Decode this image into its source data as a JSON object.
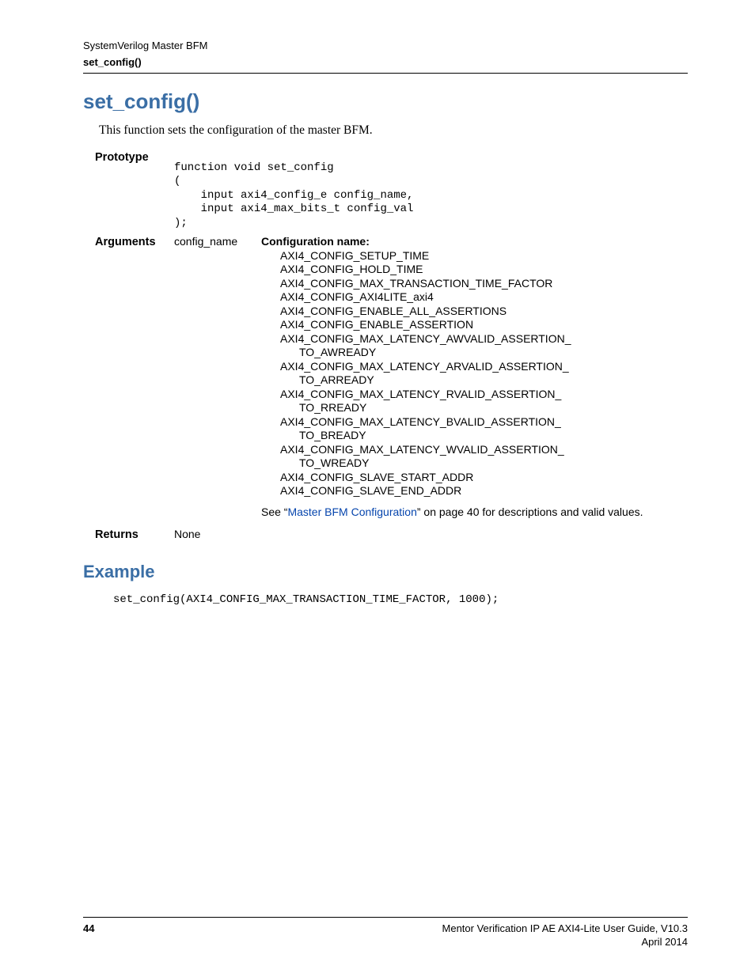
{
  "header": {
    "line1": "SystemVerilog Master BFM",
    "line2": "set_config()"
  },
  "title": "set_config()",
  "intro": "This function sets the configuration of the master BFM.",
  "prototype": {
    "label": "Prototype",
    "code": "function void set_config\n(\n    input axi4_config_e config_name,\n    input axi4_max_bits_t config_val\n);"
  },
  "arguments": {
    "label": "Arguments",
    "arg_name": "config_name",
    "desc_label": "Configuration name:",
    "items": [
      "AXI4_CONFIG_SETUP_TIME",
      "AXI4_CONFIG_HOLD_TIME",
      "AXI4_CONFIG_MAX_TRANSACTION_TIME_FACTOR",
      "AXI4_CONFIG_AXI4LITE_axi4",
      "AXI4_CONFIG_ENABLE_ALL_ASSERTIONS",
      "AXI4_CONFIG_ENABLE_ASSERTION"
    ],
    "wrapped": [
      {
        "line1": "AXI4_CONFIG_MAX_LATENCY_AWVALID_ASSERTION_",
        "line2": "TO_AWREADY"
      },
      {
        "line1": "AXI4_CONFIG_MAX_LATENCY_ARVALID_ASSERTION_",
        "line2": "TO_ARREADY"
      },
      {
        "line1": "AXI4_CONFIG_MAX_LATENCY_RVALID_ASSERTION_",
        "line2": "TO_RREADY"
      },
      {
        "line1": "AXI4_CONFIG_MAX_LATENCY_BVALID_ASSERTION_",
        "line2": "TO_BREADY"
      },
      {
        "line1": "AXI4_CONFIG_MAX_LATENCY_WVALID_ASSERTION_",
        "line2": "TO_WREADY"
      }
    ],
    "items_after": [
      "AXI4_CONFIG_SLAVE_START_ADDR",
      "AXI4_CONFIG_SLAVE_END_ADDR"
    ],
    "see_prefix": "See “",
    "see_link": "Master BFM Configuration",
    "see_suffix": "” on page 40 for descriptions and valid values."
  },
  "returns": {
    "label": "Returns",
    "value": "None"
  },
  "example": {
    "label": "Example",
    "code": "set_config(AXI4_CONFIG_MAX_TRANSACTION_TIME_FACTOR, 1000);"
  },
  "footer": {
    "page": "44",
    "line1": "Mentor Verification IP AE AXI4-Lite User Guide, V10.3",
    "line2": "April 2014"
  }
}
